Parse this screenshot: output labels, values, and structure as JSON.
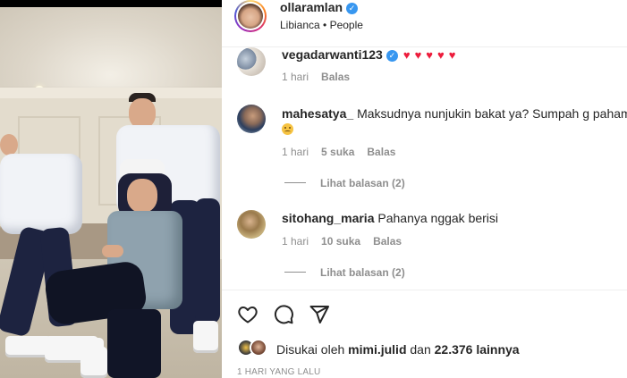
{
  "post": {
    "author": {
      "username": "ollaramlan",
      "verified_badge": "verified-icon",
      "subtitle": "Libianca • People"
    },
    "media": {
      "type": "video-frame"
    },
    "comments": [
      {
        "username": "vegadarwanti123",
        "verified_badge": "verified-icon",
        "text": "",
        "hearts": "♥♥♥♥♥",
        "heart_color": "#ed1c3c",
        "time": "1 hari",
        "likes": "",
        "reply_label": "Balas",
        "view_replies": ""
      },
      {
        "username": "mahesatya_",
        "text": "Maksudnya nunjukin bakat ya? Sumpah g paham",
        "emoji": "confused-face-icon",
        "time": "1 hari",
        "likes": "5 suka",
        "reply_label": "Balas",
        "view_replies": "Lihat balasan (2)"
      },
      {
        "username": "sitohang_maria",
        "text": "Pahanya nggak berisi",
        "time": "1 hari",
        "likes": "10 suka",
        "reply_label": "Balas",
        "view_replies": "Lihat balasan (2)"
      }
    ],
    "actions": {
      "like_icon": "heart-icon",
      "comment_icon": "comment-icon",
      "share_icon": "share-icon"
    },
    "liked_by": {
      "prefix": "Disukai oleh",
      "user": "mimi.julid",
      "conjunction": "dan",
      "others": "22.376 lainnya"
    },
    "timestamp": "1 HARI YANG LALU"
  }
}
